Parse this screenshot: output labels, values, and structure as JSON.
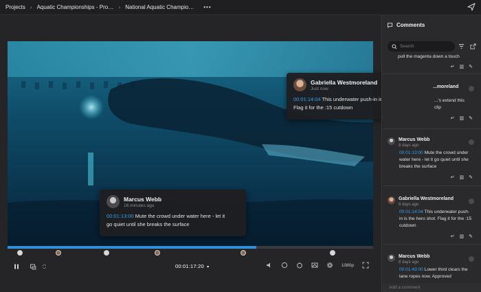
{
  "breadcrumb": {
    "items": [
      "Projects",
      "Aquatic Championships - Promo",
      "National Aquatic Championship..."
    ],
    "more": "•••"
  },
  "player": {
    "timecode": "00:01:17:20",
    "quality": "1080p",
    "progress": 0.68
  },
  "overlays": [
    {
      "name": "Gabriella Westmoreland",
      "time": "Just now",
      "timecode": "00:01:14:04",
      "text_first": "This underwater push-in is the hero shot.",
      "text_second": "Flag it for the :15 cutdown"
    },
    {
      "name": "Marcus Webb",
      "time": "16 minutes ago",
      "timecode": "00:01:13:00",
      "text_first": "Mute the crowd under water here - let it",
      "text_second": "go quiet until she breaks the surface"
    }
  ],
  "panel": {
    "title": "Comments",
    "search_placeholder": "Search",
    "add_comment_placeholder": "Add a comment",
    "partial_top": "pull the magenta down a touch",
    "partial_second_name": "...moreland",
    "partial_second_text": "...'s extend this clip",
    "comments": [
      {
        "name": "Marcus Webb",
        "when": "8 days ago",
        "timecode": "00:01:13:00",
        "text": "Mute the crowd under water here - let it go quiet until she breaks the surface"
      },
      {
        "name": "Gabriella Westmoreland",
        "when": "8 days ago",
        "timecode": "00:01:14:04",
        "text": "This underwater push-in is the hero shot. Flag it for the :15 cutdown"
      },
      {
        "name": "Marcus Webb",
        "when": "8 days ago",
        "timecode": "00:01:43:00",
        "text": "Lower third clears the lane ropes now. Approved"
      }
    ]
  },
  "colors": {
    "accent": "#2f8fd8",
    "timecode": "#3aa0ef",
    "background": "#252527",
    "panel": "#2a2a2d"
  },
  "icons": [
    "send-icon",
    "comments-icon",
    "search-icon",
    "filter-icon",
    "export-icon",
    "play-pause-icon",
    "frame-icon",
    "loop-icon",
    "volume-icon",
    "timer-icon",
    "speed-icon",
    "annotate-icon",
    "settings-icon",
    "fullscreen-icon",
    "reply-icon",
    "delete-icon",
    "edit-icon"
  ]
}
